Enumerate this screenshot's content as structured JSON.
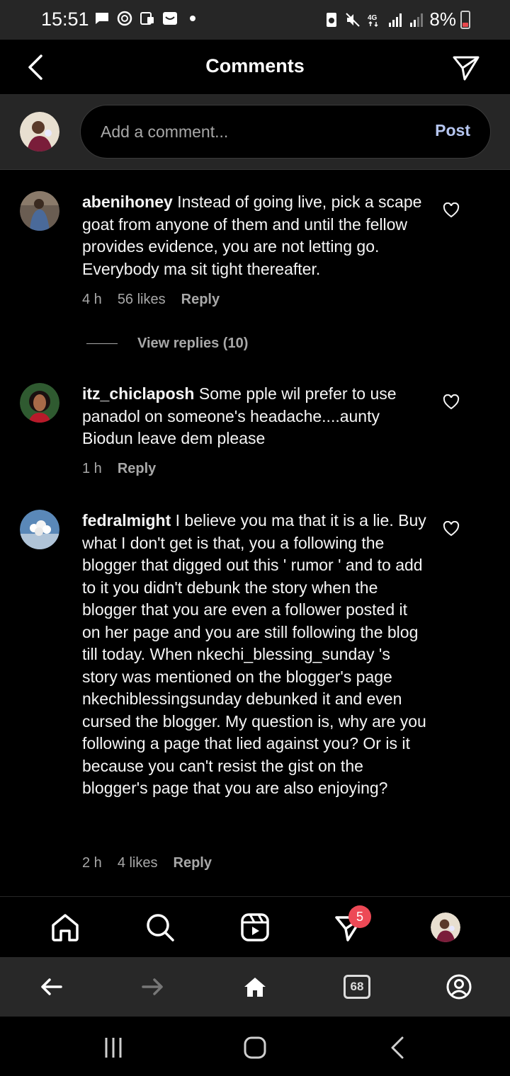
{
  "status_bar": {
    "time": "15:51",
    "battery": "8%",
    "icons": [
      "chat-icon",
      "activity-icon",
      "clipboard-icon",
      "mail-icon",
      "dot-icon",
      "recycle-icon",
      "mute-icon",
      "4g-icon",
      "signal-icon",
      "signal-icon-2"
    ],
    "network": "4G"
  },
  "header": {
    "title": "Comments",
    "back_icon": "back-chevron-icon",
    "send_icon": "send-icon"
  },
  "composer": {
    "placeholder": "Add a comment...",
    "post_label": "Post"
  },
  "comments": [
    {
      "username": "abenihoney",
      "text": " Instead of going live, pick a scape goat from anyone of them and until the fellow provides evidence, you are not letting go. Everybody ma sit tight thereafter.",
      "time": "4 h",
      "likes": "56 likes",
      "reply": "Reply",
      "view_replies": "View replies (10)"
    },
    {
      "username": "itz_chiclaposh",
      "text": " Some pple wil prefer to use panadol on someone's headache....aunty Biodun leave dem please",
      "time": "1 h",
      "likes": "",
      "reply": "Reply"
    },
    {
      "username": "fedralmight",
      "text": " I believe you ma that it is a lie. Buy what I don't get is that, you a following the blogger that digged out this ' rumor ' and to add to it you didn't debunk the story when the blogger that you are even a follower posted it on her page and you are still following the blog till today. When nkechi_blessing_sunday 's story was mentioned on the blogger's page nkechiblessingsunday debunked it and even cursed the blogger. My question is, why are you following a page that lied against you? Or is it because you can't resist the gist on the blogger's page that you are also enjoying?",
      "time": "2 h",
      "likes": "4 likes",
      "reply": "Reply"
    }
  ],
  "app_nav": {
    "items": [
      "home-icon",
      "search-icon",
      "reels-icon",
      "direct-icon",
      "profile-avatar"
    ],
    "badge": "5"
  },
  "browser_bar": {
    "tabs_count": "68"
  },
  "colors": {
    "background": "#000000",
    "surface": "#262626",
    "text": "#f5f5f5",
    "secondary_text": "#a8a8a8",
    "post_button": "#b6c6f0",
    "badge": "#ed4956"
  }
}
